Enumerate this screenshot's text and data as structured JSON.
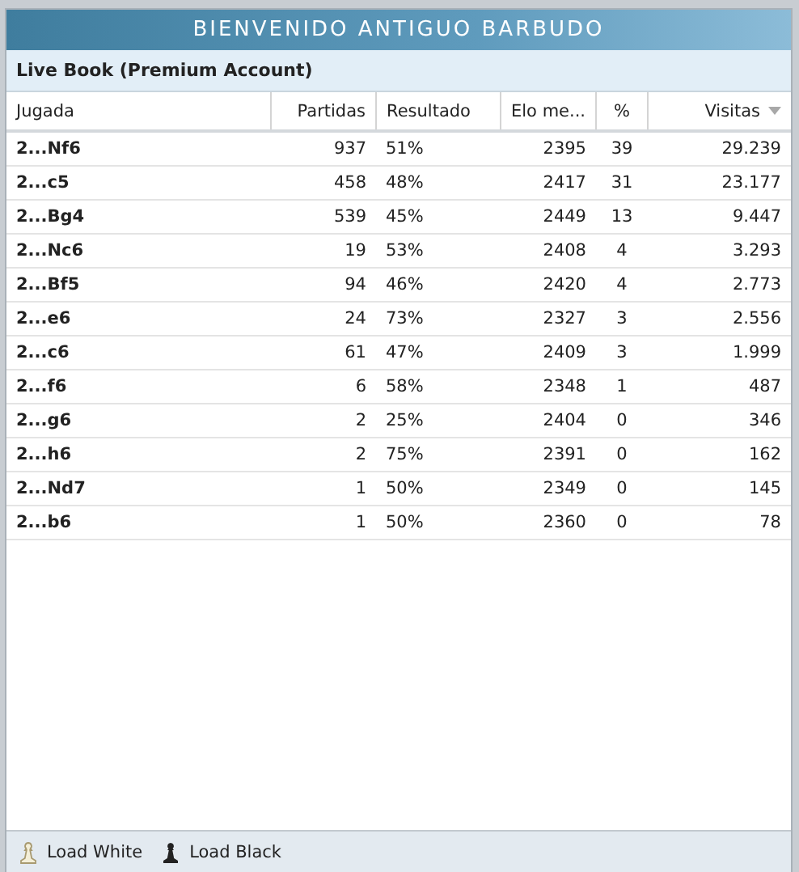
{
  "window": {
    "title": "BIENVENIDO ANTIGUO BARBUDO"
  },
  "panel": {
    "title": "Live Book (Premium Account)"
  },
  "table": {
    "columns": [
      {
        "label": "Jugada",
        "sorted": false
      },
      {
        "label": "Partidas",
        "sorted": false
      },
      {
        "label": "Resultado",
        "sorted": false
      },
      {
        "label": "Elo me...",
        "sorted": false
      },
      {
        "label": "%",
        "sorted": false
      },
      {
        "label": "Visitas",
        "sorted": true
      }
    ],
    "rows": [
      [
        "2...Nf6",
        "937",
        "51%",
        "2395",
        "39",
        "29.239"
      ],
      [
        "2...c5",
        "458",
        "48%",
        "2417",
        "31",
        "23.177"
      ],
      [
        "2...Bg4",
        "539",
        "45%",
        "2449",
        "13",
        "9.447"
      ],
      [
        "2...Nc6",
        "19",
        "53%",
        "2408",
        "4",
        "3.293"
      ],
      [
        "2...Bf5",
        "94",
        "46%",
        "2420",
        "4",
        "2.773"
      ],
      [
        "2...e6",
        "24",
        "73%",
        "2327",
        "3",
        "2.556"
      ],
      [
        "2...c6",
        "61",
        "47%",
        "2409",
        "3",
        "1.999"
      ],
      [
        "2...f6",
        "6",
        "58%",
        "2348",
        "1",
        "487"
      ],
      [
        "2...g6",
        "2",
        "25%",
        "2404",
        "0",
        "346"
      ],
      [
        "2...h6",
        "2",
        "75%",
        "2391",
        "0",
        "162"
      ],
      [
        "2...Nd7",
        "1",
        "50%",
        "2349",
        "0",
        "145"
      ],
      [
        "2...b6",
        "1",
        "50%",
        "2360",
        "0",
        "78"
      ]
    ]
  },
  "footer": {
    "buttons": [
      {
        "label": "Load White",
        "kind": "white"
      },
      {
        "label": "Load Black",
        "kind": "black"
      }
    ]
  }
}
